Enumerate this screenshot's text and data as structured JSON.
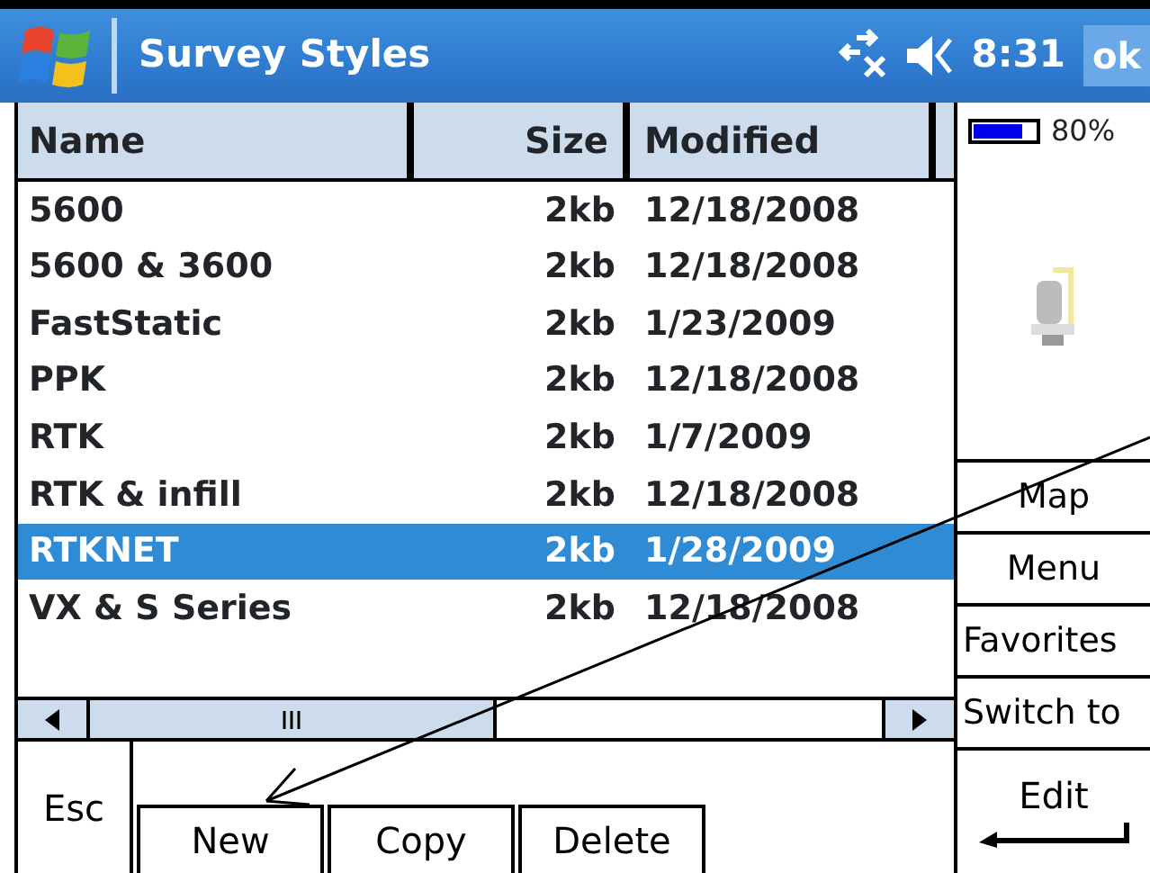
{
  "title_bar": {
    "title": "Survey Styles",
    "clock": "8:31",
    "ok_button": "ok"
  },
  "table": {
    "columns": [
      "Name",
      "Size",
      "Modified"
    ],
    "rows": [
      {
        "name": "5600",
        "size": "2kb",
        "modified": "12/18/2008",
        "selected": false
      },
      {
        "name": "5600 & 3600",
        "size": "2kb",
        "modified": "12/18/2008",
        "selected": false
      },
      {
        "name": "FastStatic",
        "size": "2kb",
        "modified": "1/23/2009",
        "selected": false
      },
      {
        "name": "PPK",
        "size": "2kb",
        "modified": "12/18/2008",
        "selected": false
      },
      {
        "name": "RTK",
        "size": "2kb",
        "modified": "1/7/2009",
        "selected": false
      },
      {
        "name": "RTK & infill",
        "size": "2kb",
        "modified": "12/18/2008",
        "selected": false
      },
      {
        "name": "RTKNET",
        "size": "2kb",
        "modified": "1/28/2009",
        "selected": true
      },
      {
        "name": "VX & S Series",
        "size": "2kb",
        "modified": "12/18/2008",
        "selected": false
      }
    ]
  },
  "bottom_bar": {
    "esc": "Esc",
    "buttons": [
      "New",
      "Copy",
      "Delete"
    ]
  },
  "side_panel": {
    "battery": {
      "level": 0.8,
      "reading": "80%"
    },
    "buttons": [
      "Map",
      "Menu",
      "Favorites",
      "Switch to"
    ],
    "edit": "Edit"
  }
}
